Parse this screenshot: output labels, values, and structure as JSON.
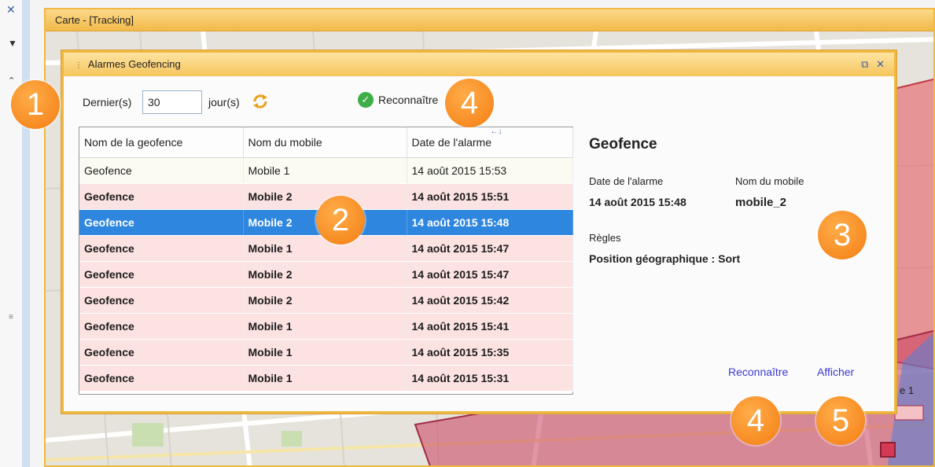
{
  "map_window": {
    "title": "Carte - [Tracking]"
  },
  "map": {
    "label_fragment": "e 1"
  },
  "dialog": {
    "title": "Alarmes Geofencing",
    "toolbar": {
      "last_label": "Dernier(s)",
      "days_value": "30",
      "days_label": "jour(s)",
      "acknowledge_label": "Reconnaître"
    },
    "table": {
      "columns": [
        "Nom de la geofence",
        "Nom du mobile",
        "Date de l'alarme"
      ],
      "rows": [
        {
          "geofence": "Geofence",
          "mobile": "Mobile 1",
          "date": "14 août 2015  15:53",
          "state": "normal"
        },
        {
          "geofence": "Geofence",
          "mobile": "Mobile 2",
          "date": "14 août 2015  15:51",
          "state": "alert"
        },
        {
          "geofence": "Geofence",
          "mobile": "Mobile 2",
          "date": "14 août 2015  15:48",
          "state": "selected"
        },
        {
          "geofence": "Geofence",
          "mobile": "Mobile 1",
          "date": "14 août 2015  15:47",
          "state": "alert"
        },
        {
          "geofence": "Geofence",
          "mobile": "Mobile 2",
          "date": "14 août 2015  15:47",
          "state": "alert"
        },
        {
          "geofence": "Geofence",
          "mobile": "Mobile 2",
          "date": "14 août 2015  15:42",
          "state": "alert"
        },
        {
          "geofence": "Geofence",
          "mobile": "Mobile 1",
          "date": "14 août 2015  15:41",
          "state": "alert"
        },
        {
          "geofence": "Geofence",
          "mobile": "Mobile 1",
          "date": "14 août 2015  15:35",
          "state": "alert"
        },
        {
          "geofence": "Geofence",
          "mobile": "Mobile 1",
          "date": "14 août 2015  15:31",
          "state": "alert"
        }
      ]
    },
    "details": {
      "heading": "Geofence",
      "alarm_date_label": "Date de l'alarme",
      "alarm_date_value": "14 août 2015  15:48",
      "mobile_label": "Nom du mobile",
      "mobile_value": "mobile_2",
      "rules_label": "Règles",
      "rules_value": "Position géographique : Sort"
    },
    "actions": {
      "acknowledge": "Reconnaître",
      "show": "Afficher"
    }
  },
  "callouts": [
    "1",
    "2",
    "3",
    "4",
    "4",
    "5"
  ],
  "colors": {
    "accent_orange": "#f47d12",
    "title_bar": "#f6c45c",
    "selected_row": "#2e86de",
    "alert_row": "#fde2e2",
    "link": "#3b3bd0"
  }
}
